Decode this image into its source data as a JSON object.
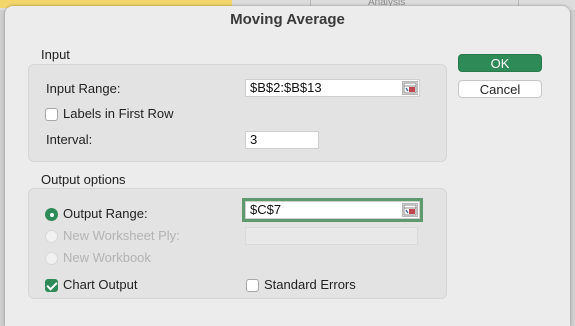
{
  "background": {
    "partial_tab": "Analysis"
  },
  "dialog": {
    "title": "Moving Average"
  },
  "input_group": {
    "label": "Input",
    "input_range_label": "Input Range:",
    "input_range_value": "$B$2:$B$13",
    "labels_first_row_label": "Labels in First Row",
    "labels_first_row_checked": false,
    "interval_label": "Interval:",
    "interval_value": "3"
  },
  "output_group": {
    "label": "Output options",
    "output_range_label": "Output Range:",
    "output_range_value": "$C$7",
    "output_range_selected": true,
    "new_worksheet_label": "New Worksheet Ply:",
    "new_worksheet_value": "",
    "new_workbook_label": "New Workbook",
    "chart_output_label": "Chart Output",
    "chart_output_checked": true,
    "standard_errors_label": "Standard Errors",
    "standard_errors_checked": false
  },
  "buttons": {
    "ok": "OK",
    "cancel": "Cancel"
  },
  "colors": {
    "accent": "#2e8b57",
    "focus_ring": "#5e9a6e"
  }
}
